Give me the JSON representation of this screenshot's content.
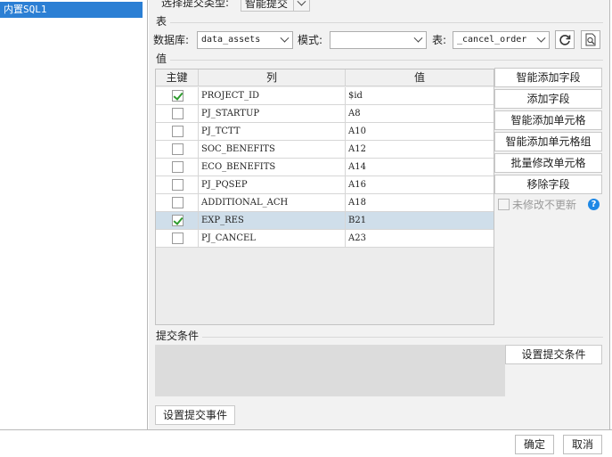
{
  "left_panel": {
    "selected_item": "内置SQL1"
  },
  "submit_type": {
    "label": "选择提交类型:",
    "value": "智能提交"
  },
  "table_section": {
    "title": "表",
    "database_label": "数据库:",
    "database_value": "data_assets",
    "schema_label": "模式:",
    "schema_value": "",
    "table_label": "表:",
    "table_value": "_cancel_order",
    "refresh_icon": "refresh-icon",
    "preview_icon": "preview-icon"
  },
  "value_section": {
    "title": "值",
    "columns": [
      "主键",
      "列",
      "值"
    ],
    "rows": [
      {
        "key": true,
        "column": "PROJECT_ID",
        "value": "$id",
        "selected": false
      },
      {
        "key": false,
        "column": "PJ_STARTUP",
        "value": "A8",
        "selected": false
      },
      {
        "key": false,
        "column": "PJ_TCTT",
        "value": "A10",
        "selected": false
      },
      {
        "key": false,
        "column": "SOC_BENEFITS",
        "value": "A12",
        "selected": false
      },
      {
        "key": false,
        "column": "ECO_BENEFITS",
        "value": "A14",
        "selected": false
      },
      {
        "key": false,
        "column": "PJ_PQSEP",
        "value": "A16",
        "selected": false
      },
      {
        "key": false,
        "column": "ADDITIONAL_ACH",
        "value": "A18",
        "selected": false
      },
      {
        "key": true,
        "column": "EXP_RES",
        "value": "B21",
        "selected": true
      },
      {
        "key": false,
        "column": "PJ_CANCEL",
        "value": "A23",
        "selected": false
      }
    ],
    "buttons": [
      "智能添加字段",
      "添加字段",
      "智能添加单元格",
      "智能添加单元格组",
      "批量修改单元格",
      "移除字段"
    ],
    "no_update_label": "未修改不更新",
    "help_icon": "help-icon"
  },
  "condition_section": {
    "title": "提交条件",
    "set_condition_button": "设置提交条件",
    "set_event_button": "设置提交事件"
  },
  "footer": {
    "ok": "确定",
    "cancel": "取消"
  },
  "colors": {
    "selection_blue": "#2b7fd4",
    "row_selected": "#cfdeea",
    "check_green": "#2e9b2e",
    "help_blue": "#1e88e5"
  }
}
